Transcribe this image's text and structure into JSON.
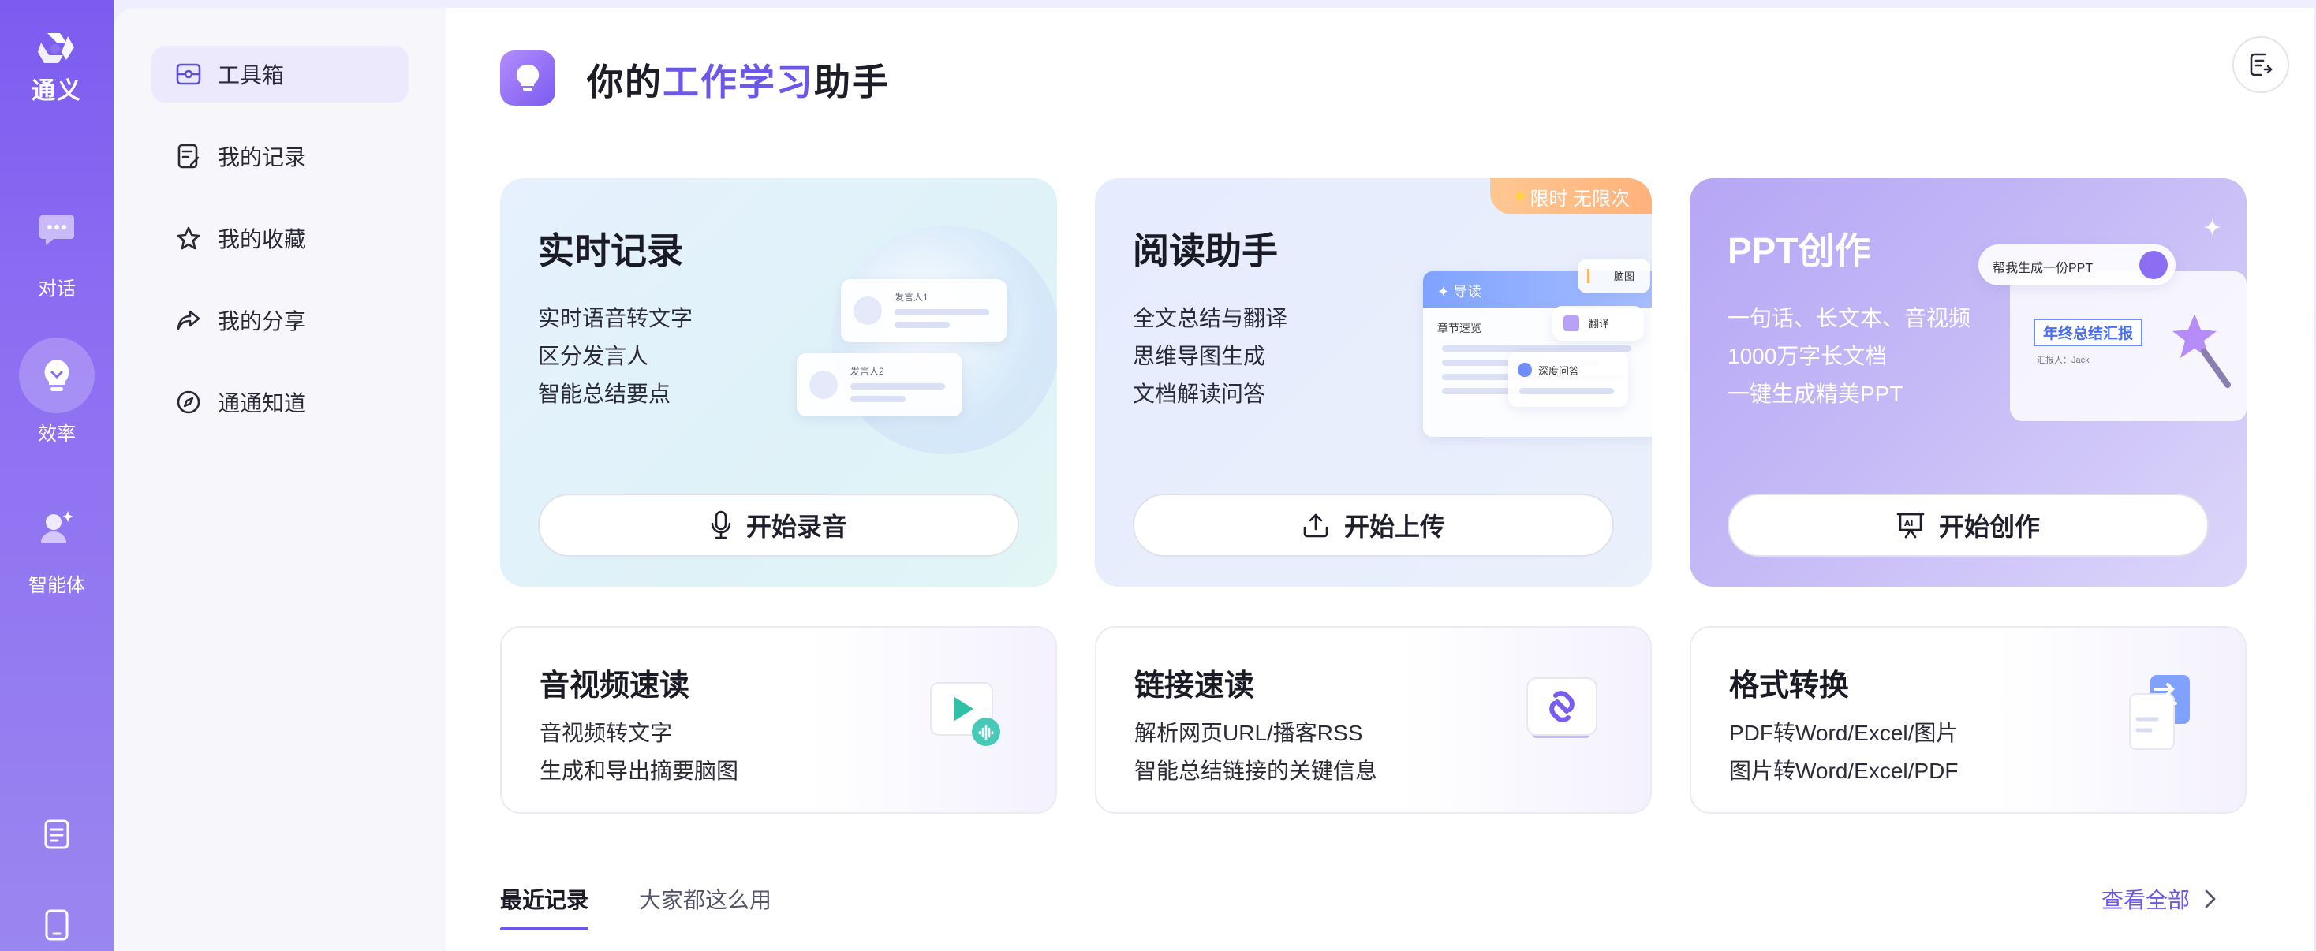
{
  "brand": {
    "name": "通义"
  },
  "rail": {
    "items": [
      {
        "label": "对话",
        "icon": "chat-bubble-icon"
      },
      {
        "label": "效率",
        "icon": "lightbulb-icon"
      },
      {
        "label": "智能体",
        "icon": "agent-icon"
      }
    ],
    "bottom": [
      {
        "icon": "document-icon"
      },
      {
        "icon": "tablet-icon"
      }
    ]
  },
  "sidebar": {
    "items": [
      {
        "label": "工具箱",
        "icon": "toolbox-icon",
        "active": true
      },
      {
        "label": "我的记录",
        "icon": "record-icon"
      },
      {
        "label": "我的收藏",
        "icon": "star-icon"
      },
      {
        "label": "我的分享",
        "icon": "share-icon"
      },
      {
        "label": "通通知道",
        "icon": "compass-icon"
      }
    ]
  },
  "header": {
    "title_pre": "你的",
    "title_highlight": "工作学习",
    "title_post": "助手",
    "action_icon": "export-icon"
  },
  "big_cards": [
    {
      "title": "实时记录",
      "lines": [
        "实时语音转文字",
        "区分发言人",
        "智能总结要点"
      ],
      "button": "开始录音",
      "button_icon": "microphone-icon",
      "deco": {
        "speaker1": "发言人1",
        "speaker2": "发言人2"
      }
    },
    {
      "title": "阅读助手",
      "badge": "限时 无限次",
      "lines": [
        "全文总结与翻译",
        "思维导图生成",
        "文档解读问答"
      ],
      "button": "开始上传",
      "button_icon": "upload-icon",
      "deco": {
        "guide": "导读",
        "mindmap": "脑图",
        "chapter": "章节速览",
        "translate": "翻译",
        "qa": "深度问答"
      }
    },
    {
      "title": "PPT创作",
      "lines": [
        "一句话、长文本、音视频",
        "1000万字长文档",
        "一键生成精美PPT"
      ],
      "button": "开始创作",
      "button_icon": "presentation-icon",
      "deco": {
        "prompt": "帮我生成一份PPT",
        "slide_title": "年终总结汇报",
        "reporter": "汇报人：Jack"
      }
    }
  ],
  "small_cards": [
    {
      "title": "音视频速读",
      "lines": [
        "音视频转文字",
        "生成和导出摘要脑图"
      ],
      "icon": "video-play-icon"
    },
    {
      "title": "链接速读",
      "lines": [
        "解析网页URL/播客RSS",
        "智能总结链接的关键信息"
      ],
      "icon": "link-icon"
    },
    {
      "title": "格式转换",
      "lines": [
        "PDF转Word/Excel/图片",
        "图片转Word/Excel/PDF"
      ],
      "icon": "file-convert-icon"
    }
  ],
  "tabs": [
    {
      "label": "最近记录",
      "active": true
    },
    {
      "label": "大家都这么用"
    }
  ],
  "view_all": "查看全部",
  "colors": {
    "accent": "#6b57e8",
    "rail": "#7b5cf0",
    "badge": "#ffb27c"
  }
}
